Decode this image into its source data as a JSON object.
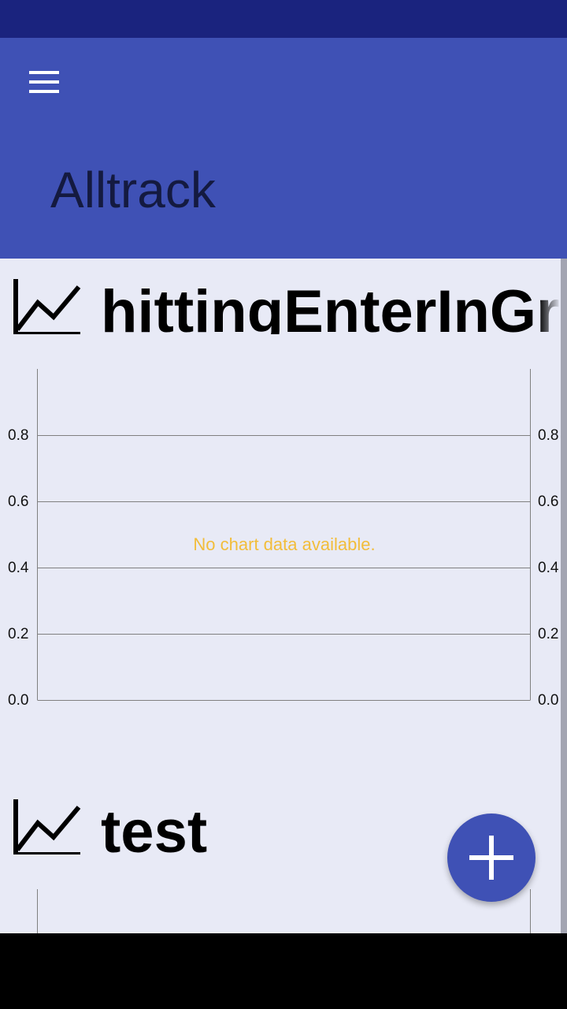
{
  "app": {
    "title": "Alltrack"
  },
  "toolbar": {
    "menu_icon": "hamburger-menu-icon"
  },
  "graphs": [
    {
      "title": "hittingEnterInGra",
      "icon": "show-chart-icon",
      "no_data_text": "No chart data available.",
      "chart_data": {
        "type": "line",
        "title": "hittingEnterInGra",
        "series": [],
        "ylim": [
          0,
          1
        ],
        "y_ticks_left": [
          "0.0",
          "0.2",
          "0.4",
          "0.6",
          "0.8"
        ],
        "y_ticks_right": [
          "0.0",
          "0.2",
          "0.4",
          "0.6",
          "0.8"
        ],
        "grid": true
      }
    },
    {
      "title": "test",
      "icon": "show-chart-icon"
    }
  ],
  "fab": {
    "icon": "plus-icon"
  },
  "colors": {
    "status_bar": "#1a237e",
    "app_bar": "#3f51b5",
    "background": "#e8eaf6",
    "no_data_text": "#f2bd3a",
    "fab": "#3f51b5"
  }
}
